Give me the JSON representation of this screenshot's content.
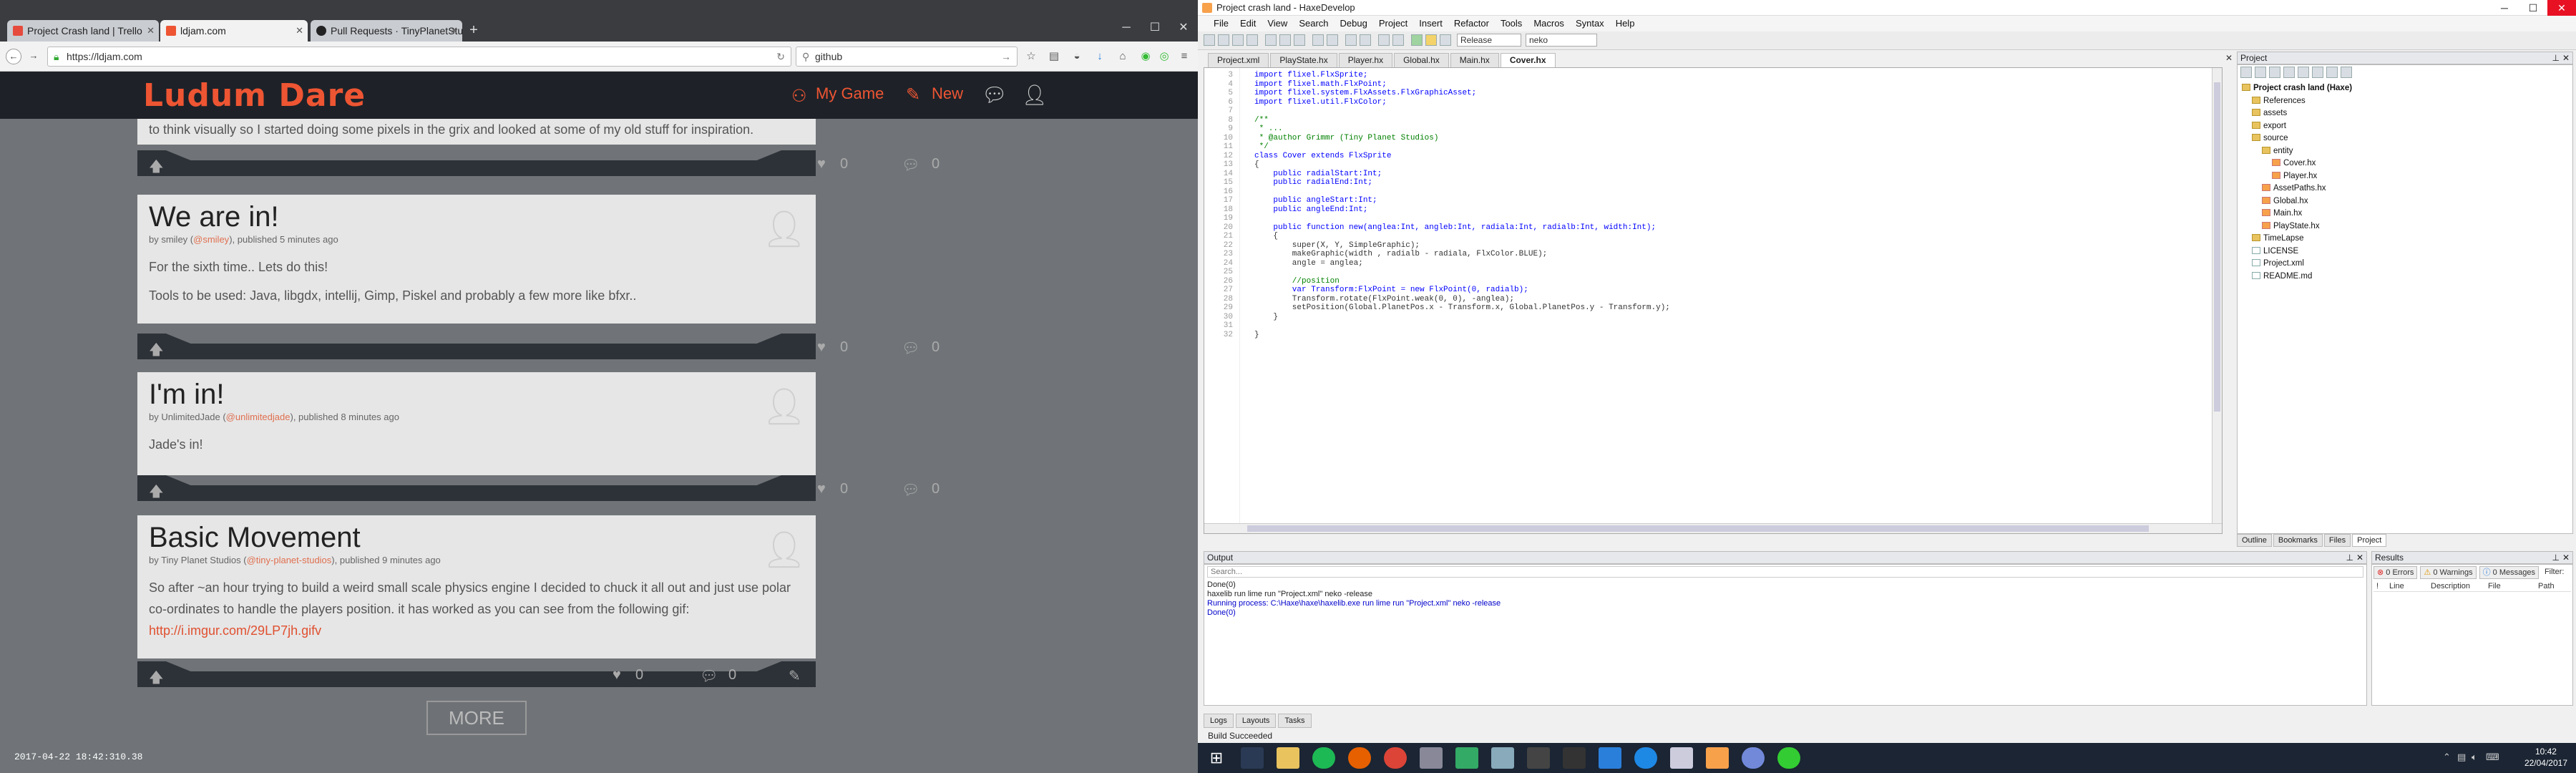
{
  "browser": {
    "tabs": [
      {
        "title": "Project Crash land | Trello",
        "active": false
      },
      {
        "title": "ldjam.com",
        "active": true
      },
      {
        "title": "Pull Requests · TinyPlanetStu...",
        "active": false
      }
    ],
    "url": "https://ldjam.com",
    "search": "github",
    "page": {
      "logo": "Ludum Dare",
      "nav": {
        "my_game": "My Game",
        "new": "New"
      },
      "partial_text": "to think visually so I started doing some pixels in the grix and looked at some of my old stuff for inspiration.",
      "posts": [
        {
          "title": "We are in!",
          "author": "smiley",
          "handle": "@smiley",
          "published": "published 5 minutes ago",
          "paragraphs": [
            "For the sixth time.. Lets do this!",
            "Tools to be used: Java, libgdx, intellij, Gimp, Piskel and probably a few more like bfxr.."
          ],
          "likes": "0",
          "comments": "0"
        },
        {
          "title": "I'm in!",
          "author": "UnlimitedJade",
          "handle": "@unlimitedjade",
          "published": "published 8 minutes ago",
          "paragraphs": [
            "Jade's in!"
          ],
          "likes": "0",
          "comments": "0"
        },
        {
          "title": "Basic Movement",
          "author": "Tiny Planet Studios",
          "handle": "@tiny-planet-studios",
          "published": "published 9 minutes ago",
          "paragraphs": [
            "So after ~an hour trying to build a weird small scale physics engine I decided to chuck it all out and just use polar co-ordinates to handle the players position. it has worked as you can see from the following gif:"
          ],
          "link": "http://i.imgur.com/29LP7jh.gifv",
          "likes": "0",
          "comments": "0"
        }
      ],
      "top_bar": {
        "likes": "0",
        "comments": "0"
      },
      "more": "MORE"
    },
    "timestamp": "2017-04-22 18:42:310.38"
  },
  "ide": {
    "title": "Project crash land - HaxeDevelop",
    "menu": [
      "File",
      "Edit",
      "View",
      "Search",
      "Debug",
      "Project",
      "Insert",
      "Refactor",
      "Tools",
      "Macros",
      "Syntax",
      "Help"
    ],
    "build_config": "Release",
    "target": "neko",
    "doc_tabs": [
      "Project.xml",
      "PlayState.hx",
      "Player.hx",
      "Global.hx",
      "Main.hx",
      "Cover.hx"
    ],
    "active_tab": "Cover.hx",
    "code": [
      {
        "n": "3",
        "t": "import flixel.FlxSprite;"
      },
      {
        "n": "4",
        "t": "import flixel.math.FlxPoint;"
      },
      {
        "n": "5",
        "t": "import flixel.system.FlxAssets.FlxGraphicAsset;"
      },
      {
        "n": "6",
        "t": "import flixel.util.FlxColor;"
      },
      {
        "n": "7",
        "t": ""
      },
      {
        "n": "8",
        "t": "/**"
      },
      {
        "n": "9",
        "t": " * ..."
      },
      {
        "n": "10",
        "t": " * @author Grimmr (Tiny Planet Studios)"
      },
      {
        "n": "11",
        "t": " */"
      },
      {
        "n": "12",
        "t": "class Cover extends FlxSprite"
      },
      {
        "n": "13",
        "t": "{"
      },
      {
        "n": "14",
        "t": "    public radialStart:Int;"
      },
      {
        "n": "15",
        "t": "    public radialEnd:Int;"
      },
      {
        "n": "16",
        "t": ""
      },
      {
        "n": "17",
        "t": "    public angleStart:Int;"
      },
      {
        "n": "18",
        "t": "    public angleEnd:Int;"
      },
      {
        "n": "19",
        "t": ""
      },
      {
        "n": "20",
        "t": "    public function new(anglea:Int, angleb:Int, radiala:Int, radialb:Int, width:Int);"
      },
      {
        "n": "21",
        "t": "    {"
      },
      {
        "n": "22",
        "t": "        super(X, Y, SimpleGraphic);"
      },
      {
        "n": "23",
        "t": "        makeGraphic(width , radialb - radiala, FlxColor.BLUE);"
      },
      {
        "n": "24",
        "t": "        angle = anglea;"
      },
      {
        "n": "25",
        "t": ""
      },
      {
        "n": "26",
        "t": "        //position"
      },
      {
        "n": "27",
        "t": "        var Transform:FlxPoint = new FlxPoint(0, radialb);"
      },
      {
        "n": "28",
        "t": "        Transform.rotate(FlxPoint.weak(0, 0), -anglea);"
      },
      {
        "n": "29",
        "t": "        setPosition(Global.PlanetPos.x - Transform.x, Global.PlanetPos.y - Transform.y);"
      },
      {
        "n": "30",
        "t": "    }"
      },
      {
        "n": "31",
        "t": ""
      },
      {
        "n": "32",
        "t": "}"
      }
    ],
    "project_panel": {
      "title": "Project",
      "tree": [
        {
          "label": "Project crash land (Haxe)",
          "depth": 0,
          "kind": "root"
        },
        {
          "label": "References",
          "depth": 1,
          "kind": "folder"
        },
        {
          "label": "assets",
          "depth": 1,
          "kind": "folder"
        },
        {
          "label": "export",
          "depth": 1,
          "kind": "folder"
        },
        {
          "label": "source",
          "depth": 1,
          "kind": "folder"
        },
        {
          "label": "entity",
          "depth": 2,
          "kind": "folder"
        },
        {
          "label": "Cover.hx",
          "depth": 3,
          "kind": "hx"
        },
        {
          "label": "Player.hx",
          "depth": 3,
          "kind": "hx"
        },
        {
          "label": "AssetPaths.hx",
          "depth": 2,
          "kind": "hx"
        },
        {
          "label": "Global.hx",
          "depth": 2,
          "kind": "hx"
        },
        {
          "label": "Main.hx",
          "depth": 2,
          "kind": "hx"
        },
        {
          "label": "PlayState.hx",
          "depth": 2,
          "kind": "hx"
        },
        {
          "label": "TimeLapse",
          "depth": 1,
          "kind": "folder"
        },
        {
          "label": "LICENSE",
          "depth": 1,
          "kind": "file"
        },
        {
          "label": "Project.xml",
          "depth": 1,
          "kind": "file"
        },
        {
          "label": "README.md",
          "depth": 1,
          "kind": "file"
        }
      ],
      "tabs": [
        "Outline",
        "Bookmarks",
        "Files",
        "Project"
      ]
    },
    "output": {
      "title": "Output",
      "search_placeholder": "Search...",
      "lines": [
        "Done(0)",
        "haxelib run lime run \"Project.xml\" neko -release",
        "Running process: C:\\Haxe\\haxe\\haxelib.exe run lime run \"Project.xml\" neko -release",
        "Done(0)"
      ]
    },
    "results": {
      "title": "Results",
      "errors": "0 Errors",
      "warnings": "0 Warnings",
      "messages": "0 Messages",
      "filter_label": "Filter:",
      "columns": [
        "!",
        "Line",
        "Description",
        "File",
        "Path"
      ]
    },
    "bottom_tabs": [
      "Logs",
      "Layouts",
      "Tasks"
    ],
    "status": "Build Succeeded"
  },
  "taskbar": {
    "time": "10:42",
    "date": "22/04/2017"
  },
  "colors": {
    "ld_accent": "#ee5533",
    "page_bg": "#707478",
    "taskbar": "#1b2533"
  }
}
